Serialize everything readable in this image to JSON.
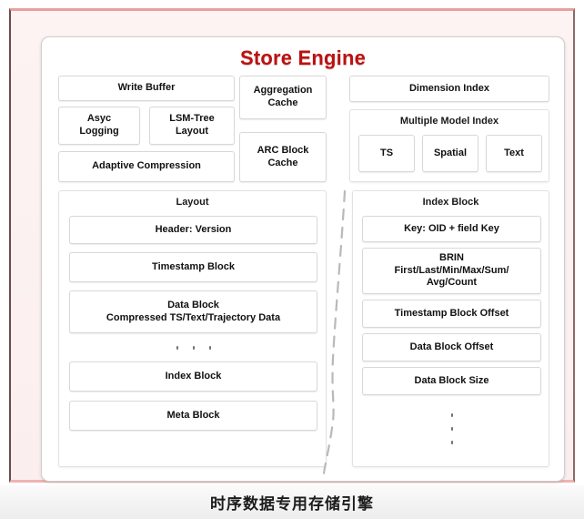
{
  "frame": {
    "border_color": "#e8a0a0",
    "inner_bg": "#fdf3f3"
  },
  "card": {
    "title": "Store Engine",
    "title_color": "#bb1111"
  },
  "top_section": {
    "left_column": {
      "write_buffer": "Write Buffer",
      "asyc_logging": "Asyc\nLogging",
      "lsm_tree_layout": "LSM-Tree\nLayout",
      "adaptive_compression": "Adaptive Compression"
    },
    "middle_column": {
      "aggregation_cache": "Aggregation\nCache",
      "arc_block_cache": "ARC Block\nCache"
    },
    "right_column": {
      "dimension_index": "Dimension Index",
      "multiple_model_index": "Multiple Model Index",
      "model_types": [
        "TS",
        "Spatial",
        "Text"
      ]
    }
  },
  "bottom_section": {
    "layout_panel": {
      "caption": "Layout",
      "rows": [
        "Header:  Version",
        "Timestamp Block",
        "Data Block\nCompressed TS/Text/Trajectory Data",
        "Index Block",
        "Meta Block"
      ],
      "ellipsis": "· · ·"
    },
    "index_panel": {
      "caption": "Index Block",
      "rows": [
        "Key: OID + field Key",
        "BRIN\nFirst/Last/Min/Max/Sum/\nAvg/Count",
        "Timestamp Block Offset",
        "Data Block Offset",
        "Data Block Size"
      ],
      "ellipsis": "⋮"
    }
  },
  "caption": {
    "text": "时序数据专用存储引擎"
  }
}
